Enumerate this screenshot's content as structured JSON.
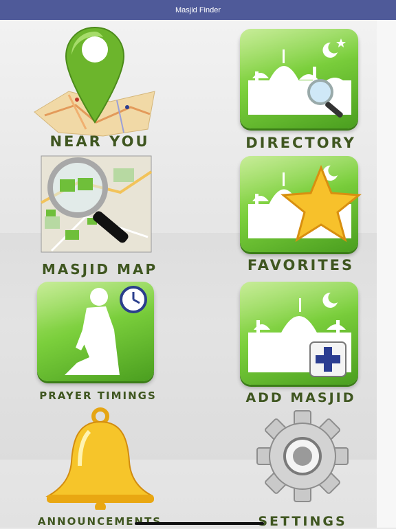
{
  "app": {
    "title": "Masjid Finder"
  },
  "menu": {
    "near_you": "NEAR YOU",
    "directory": "DIRECTORY",
    "masjid_map": "MASJID MAP",
    "favorites": "FAVORITES",
    "prayer_timings": "PRAYER TIMINGS",
    "add_masjid": "ADD MASJID",
    "announcements": "ANNOUNCEMENTS",
    "settings": "SETTINGS"
  },
  "icons": {
    "near_you": "map-pin-icon",
    "directory": "mosque-search-icon",
    "masjid_map": "map-magnifier-icon",
    "favorites": "mosque-star-icon",
    "prayer_timings": "praying-person-clock-icon",
    "add_masjid": "mosque-add-icon",
    "announcements": "bell-icon",
    "settings": "gear-icon"
  },
  "colors": {
    "navbar": "#4f5a99",
    "label": "#3f5620",
    "tile_green": "#7bcf3c"
  }
}
